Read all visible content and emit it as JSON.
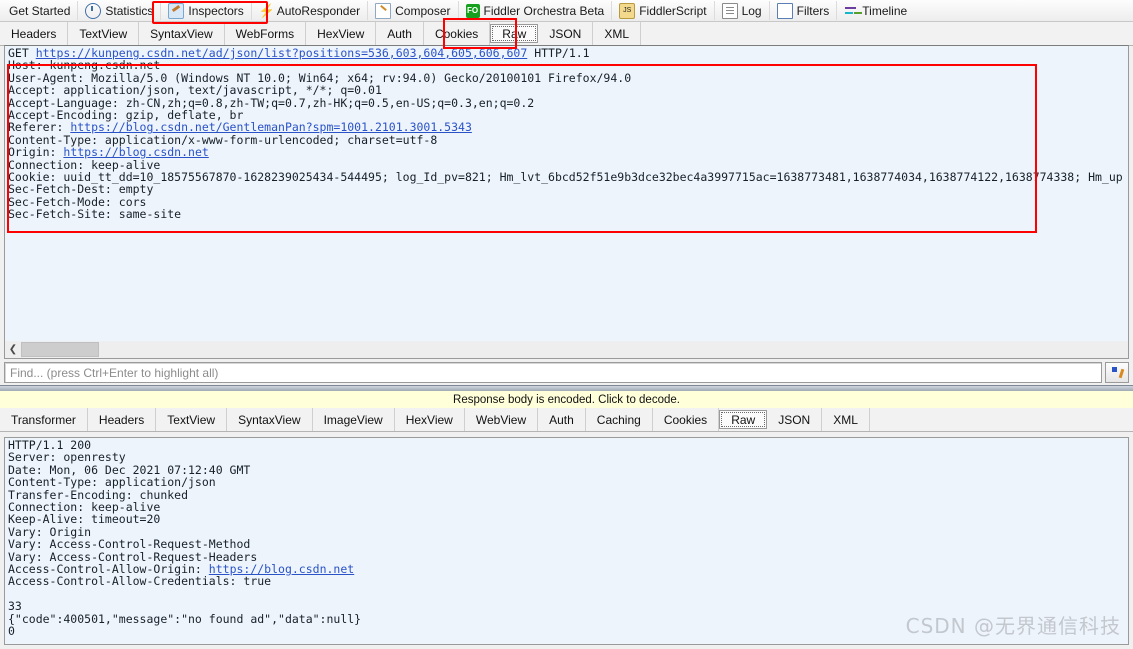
{
  "toolbar": {
    "items": [
      {
        "label": "Get Started",
        "icon": "none"
      },
      {
        "label": "Statistics",
        "icon": "stats-icon"
      },
      {
        "label": "Inspectors",
        "icon": "inspectors-icon"
      },
      {
        "label": "AutoResponder",
        "icon": "bolt-icon"
      },
      {
        "label": "Composer",
        "icon": "composer-icon"
      },
      {
        "label": "Fiddler Orchestra Beta",
        "icon": "fiddler-orchestra-icon"
      },
      {
        "label": "FiddlerScript",
        "icon": "fiddlerscript-icon"
      },
      {
        "label": "Log",
        "icon": "log-icon"
      },
      {
        "label": "Filters",
        "icon": "filters-icon"
      },
      {
        "label": "Timeline",
        "icon": "timeline-icon"
      }
    ]
  },
  "request_tabs": {
    "items": [
      "Headers",
      "TextView",
      "SyntaxView",
      "WebForms",
      "HexView",
      "Auth",
      "Cookies",
      "Raw",
      "JSON",
      "XML"
    ],
    "selected": "Raw"
  },
  "request_raw": {
    "line1_method": "GET ",
    "line1_url": "https://kunpeng.csdn.net/ad/json/list?positions=536,603,604,605,606,607",
    "line1_version": " HTTP/1.1",
    "line2": "Host: kunpeng.csdn.net",
    "line3": "User-Agent: Mozilla/5.0 (Windows NT 10.0; Win64; x64; rv:94.0) Gecko/20100101 Firefox/94.0",
    "line4": "Accept: application/json, text/javascript, */*; q=0.01",
    "line5": "Accept-Language: zh-CN,zh;q=0.8,zh-TW;q=0.7,zh-HK;q=0.5,en-US;q=0.3,en;q=0.2",
    "line6": "Accept-Encoding: gzip, deflate, br",
    "line7_key": "Referer: ",
    "line7_url": "https://blog.csdn.net/GentlemanPan?spm=1001.2101.3001.5343",
    "line8": "Content-Type: application/x-www-form-urlencoded; charset=utf-8",
    "line9_key": "Origin: ",
    "line9_url": "https://blog.csdn.net",
    "line10": "Connection: keep-alive",
    "line11": "Cookie: uuid_tt_dd=10_18575567870-1628239025434-544495; log_Id_pv=821; Hm_lvt_6bcd52f51e9b3dce32bec4a3997715ac=1638773481,1638774034,1638774122,1638774338; Hm_up",
    "line12": "Sec-Fetch-Dest: empty",
    "line13": "Sec-Fetch-Mode: cors",
    "line14": "Sec-Fetch-Site: same-site"
  },
  "find": {
    "placeholder": "Find... (press Ctrl+Enter to highlight all)",
    "value": "",
    "button_icon": "find-highlight-icon"
  },
  "notice": {
    "text": "Response body is encoded. Click to decode."
  },
  "response_tabs": {
    "items": [
      "Transformer",
      "Headers",
      "TextView",
      "SyntaxView",
      "ImageView",
      "HexView",
      "WebView",
      "Auth",
      "Caching",
      "Cookies",
      "Raw",
      "JSON",
      "XML"
    ],
    "selected": "Raw"
  },
  "response_raw": {
    "line1": "HTTP/1.1 200",
    "line2": "Server: openresty",
    "line3": "Date: Mon, 06 Dec 2021 07:12:40 GMT",
    "line4": "Content-Type: application/json",
    "line5": "Transfer-Encoding: chunked",
    "line6": "Connection: keep-alive",
    "line7": "Keep-Alive: timeout=20",
    "line8": "Vary: Origin",
    "line9": "Vary: Access-Control-Request-Method",
    "line10": "Vary: Access-Control-Request-Headers",
    "line11_key": "Access-Control-Allow-Origin: ",
    "line11_url": "https://blog.csdn.net",
    "line12": "Access-Control-Allow-Credentials: true",
    "line13": "",
    "line14": "33",
    "line15": "{\"code\":400501,\"message\":\"no found ad\",\"data\":null}",
    "line16": "0"
  },
  "scrollbar": {
    "left_arrow": "❮"
  },
  "watermark": {
    "text": "CSDN @无界通信科技"
  },
  "annotations": {
    "accent_color": "#ff0000",
    "boxes": [
      "inspectors-tab-highlight",
      "raw-tab-highlight",
      "request-headers-highlight"
    ]
  }
}
